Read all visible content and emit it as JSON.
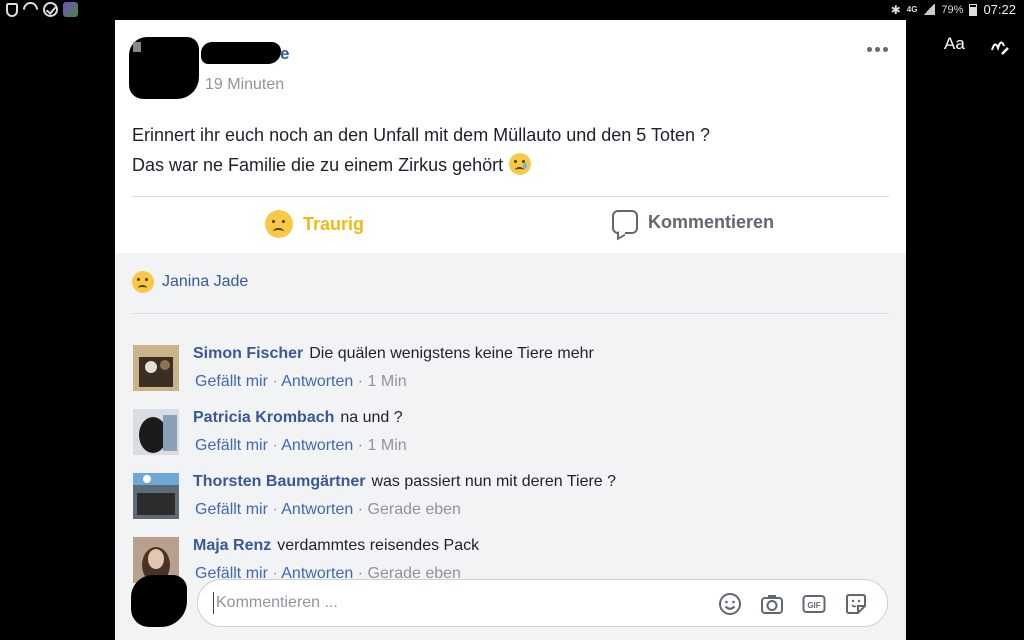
{
  "status_bar": {
    "network": "4G",
    "battery": "79%",
    "time": "07:22"
  },
  "overlay_tools": {
    "text_tool": "Aa",
    "draw_tool_icon": "pen-scribble-icon"
  },
  "post": {
    "author_visible_suffix": "e",
    "time": "19 Minuten",
    "text_line1": "Erinnert ihr euch noch an den Unfall mit dem Müllauto und den 5 Toten ?",
    "text_line2": "Das war ne Familie die zu einem Zirkus gehört",
    "text_emoji": "crying-face-emoji",
    "more_icon": "more-dots-icon"
  },
  "actions": {
    "reaction_label": "Traurig",
    "reaction_icon": "sad-reaction-icon",
    "comment_label": "Kommentieren",
    "comment_icon": "speech-bubble-icon"
  },
  "reactors": {
    "name": "Janina Jade",
    "reaction_icon": "sad-reaction-icon"
  },
  "comments": [
    {
      "name": "Simon Fischer",
      "text": "Die quälen wenigstens keine Tiere mehr",
      "like": "Gefällt mir",
      "sep1": " · ",
      "reply": "Antworten",
      "sep2": " · ",
      "time": "1 Min"
    },
    {
      "name": "Patricia Krombach",
      "text": "na und ?",
      "like": "Gefällt mir",
      "sep1": " · ",
      "reply": "Antworten",
      "sep2": " · ",
      "time": "1 Min"
    },
    {
      "name": "Thorsten Baumgärtner",
      "text": "was passiert nun mit deren Tiere ?",
      "like": "Gefällt mir",
      "sep1": " · ",
      "reply": "Antworten",
      "sep2": " · ",
      "time": "Gerade eben"
    },
    {
      "name": "Maja Renz",
      "text": "verdammtes reisendes Pack",
      "like": "Gefällt mir",
      "sep1": " · ",
      "reply": "Antworten",
      "sep2": " · ",
      "time": "Gerade eben"
    }
  ],
  "composer": {
    "placeholder": "Kommentieren ...",
    "icons": [
      "smiley-icon",
      "camera-icon",
      "gif-icon",
      "sticker-icon"
    ]
  },
  "colors": {
    "link_blue": "#385898",
    "reaction_yellow": "#f0ba15",
    "meta_gray": "#90949c",
    "comment_bg": "#f2f3f5"
  }
}
